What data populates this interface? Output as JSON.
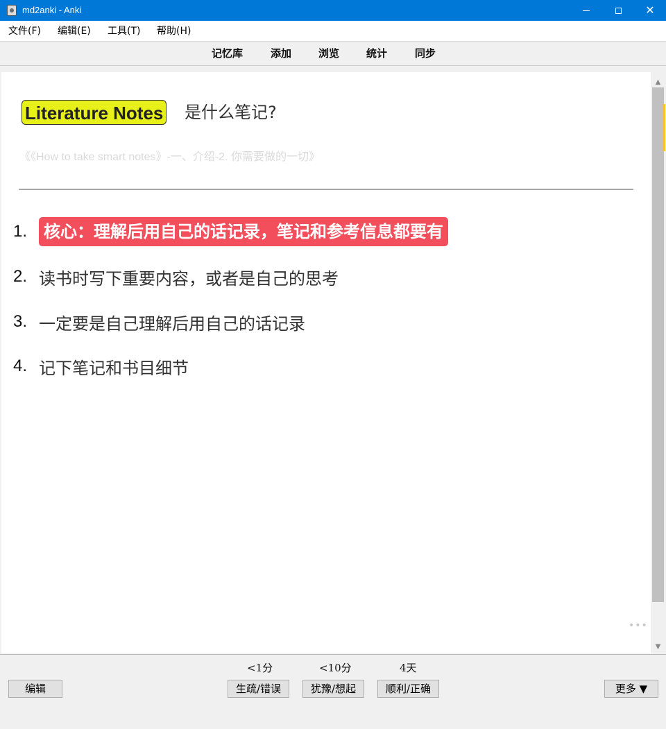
{
  "window": {
    "title": "md2anki - Anki"
  },
  "menubar": {
    "items": [
      "文件(F)",
      "编辑(E)",
      "工具(T)",
      "帮助(H)"
    ]
  },
  "toolbar": {
    "links": [
      "记忆库",
      "添加",
      "浏览",
      "统计",
      "同步"
    ]
  },
  "card": {
    "question_badge": "Literature Notes",
    "question_text": "是什么笔记?",
    "source": "《《How to take smart notes》-一、介绍-2. 你需要做的一切》",
    "answers": [
      {
        "num": "1.",
        "text": "核心：理解后用自己的话记录，笔记和参考信息都要有"
      },
      {
        "num": "2.",
        "text": "读书时写下重要内容，或者是自己的思考"
      },
      {
        "num": "3.",
        "text": "一定要是自己理解后用自己的话记录"
      },
      {
        "num": "4.",
        "text": "记下笔记和书目细节"
      }
    ],
    "dots": "•••"
  },
  "bottom": {
    "edit_label": "编辑",
    "more_label": "更多 ▼",
    "answer_buttons": [
      {
        "interval": "<1分",
        "label": "生疏/错误"
      },
      {
        "interval": "<10分",
        "label": "犹豫/想起"
      },
      {
        "interval": "4天",
        "label": "顺利/正确"
      }
    ]
  },
  "colors": {
    "titlebar": "#0078d7",
    "badge_bg": "#e8f01a",
    "highlight_bg": "#f24e5c",
    "scroll_accent": "#f5c331"
  }
}
